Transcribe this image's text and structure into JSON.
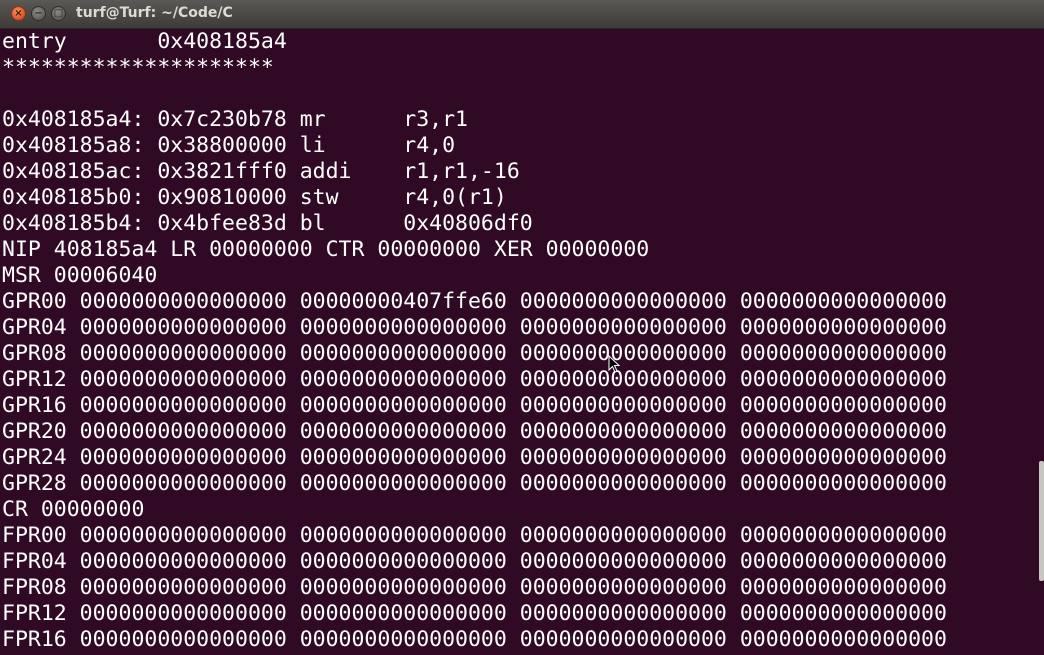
{
  "window": {
    "title": "turf@Turf: ~/Code/C",
    "close_glyph": "×",
    "minimize_glyph": "−",
    "maximize_glyph": "□"
  },
  "terminal": {
    "lines": [
      "entry       0x408185a4",
      "*********************",
      "",
      "0x408185a4: 0x7c230b78 mr      r3,r1",
      "0x408185a8: 0x38800000 li      r4,0",
      "0x408185ac: 0x3821fff0 addi    r1,r1,-16",
      "0x408185b0: 0x90810000 stw     r4,0(r1)",
      "0x408185b4: 0x4bfee83d bl      0x40806df0",
      "NIP 408185a4 LR 00000000 CTR 00000000 XER 00000000",
      "MSR 00006040",
      "GPR00 0000000000000000 00000000407ffe60 0000000000000000 0000000000000000",
      "GPR04 0000000000000000 0000000000000000 0000000000000000 0000000000000000",
      "GPR08 0000000000000000 0000000000000000 0000000000000000 0000000000000000",
      "GPR12 0000000000000000 0000000000000000 0000000000000000 0000000000000000",
      "GPR16 0000000000000000 0000000000000000 0000000000000000 0000000000000000",
      "GPR20 0000000000000000 0000000000000000 0000000000000000 0000000000000000",
      "GPR24 0000000000000000 0000000000000000 0000000000000000 0000000000000000",
      "GPR28 0000000000000000 0000000000000000 0000000000000000 0000000000000000",
      "CR 00000000",
      "FPR00 0000000000000000 0000000000000000 0000000000000000 0000000000000000",
      "FPR04 0000000000000000 0000000000000000 0000000000000000 0000000000000000",
      "FPR08 0000000000000000 0000000000000000 0000000000000000 0000000000000000",
      "FPR12 0000000000000000 0000000000000000 0000000000000000 0000000000000000",
      "FPR16 0000000000000000 0000000000000000 0000000000000000 0000000000000000"
    ]
  },
  "colors": {
    "background": "#300a24",
    "foreground": "#ffffff",
    "titlebar": "#3c3b37",
    "close_button": "#e05a2b"
  },
  "icons": {
    "close": "close-icon",
    "minimize": "minimize-icon",
    "maximize": "maximize-icon",
    "cursor": "mouse-cursor-icon"
  }
}
